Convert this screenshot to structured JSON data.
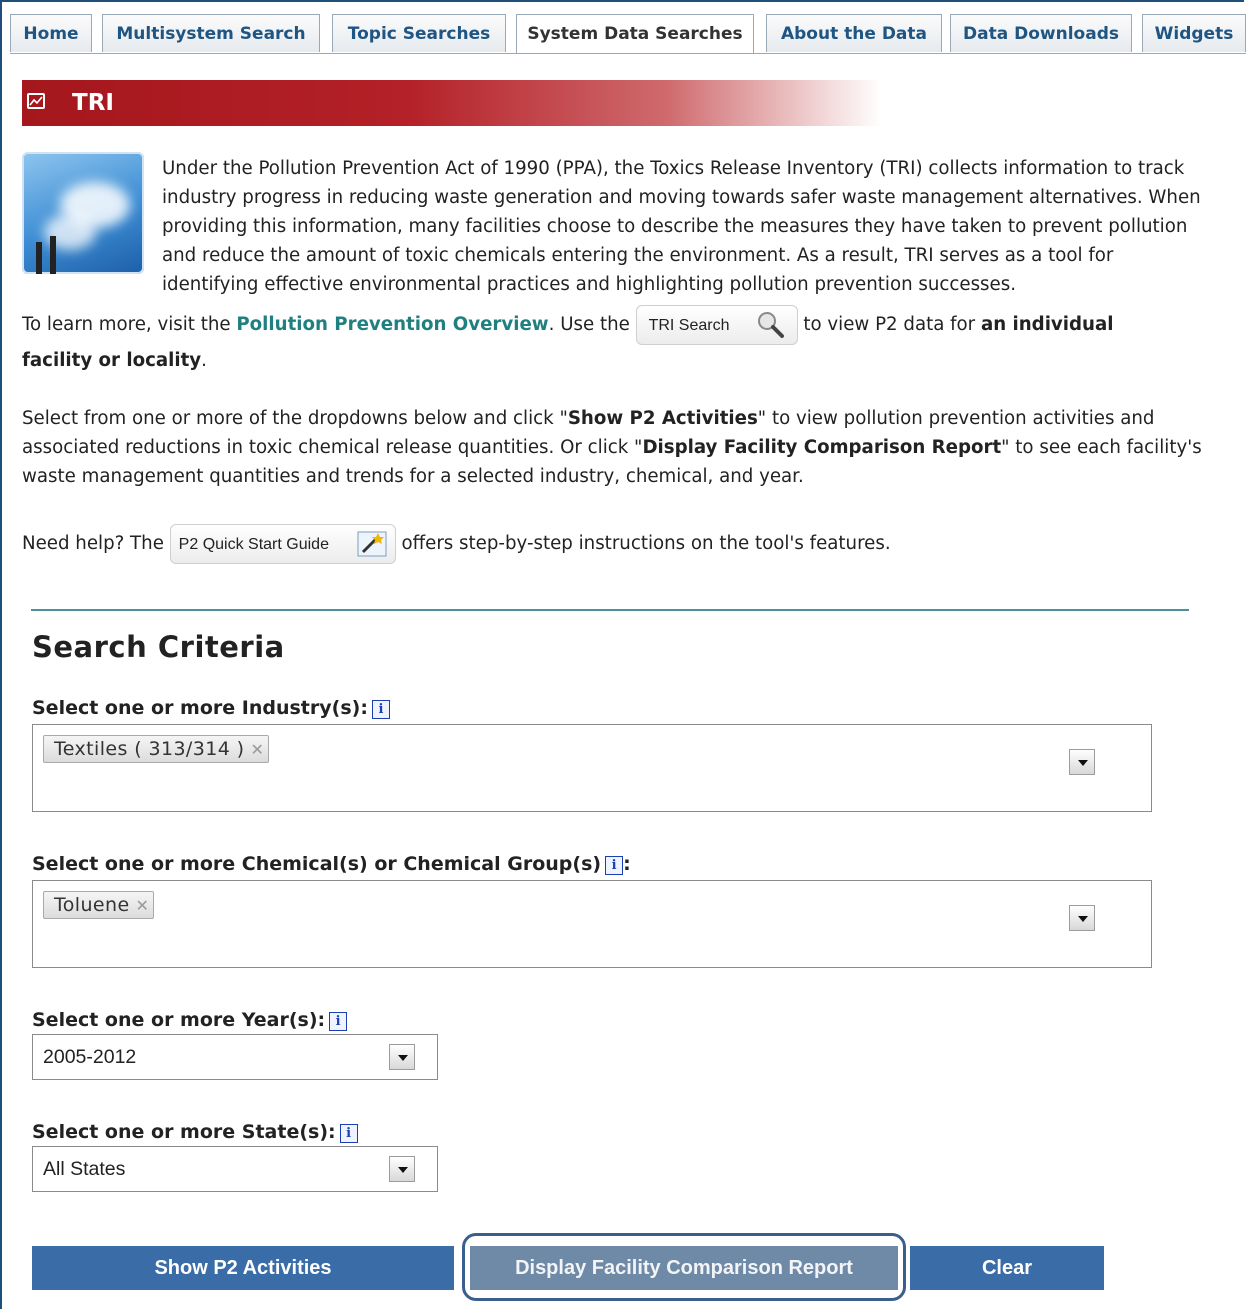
{
  "tabs": [
    {
      "label": "Home",
      "active": false
    },
    {
      "label": "Multisystem Search",
      "active": false
    },
    {
      "label": "Topic Searches",
      "active": false
    },
    {
      "label": "System Data Searches",
      "active": true
    },
    {
      "label": "About the Data",
      "active": false
    },
    {
      "label": "Data Downloads",
      "active": false
    },
    {
      "label": "Widgets",
      "active": false
    }
  ],
  "banner": {
    "title": "TRI",
    "icon": "chart-icon"
  },
  "intro": {
    "image": "smokestack-photo",
    "text": "Under the Pollution Prevention Act of 1990 (PPA), the Toxics Release Inventory (TRI) collects information to track\nindustry progress in reducing waste generation and moving towards safer waste management alternatives. When\nproviding this information, many facilities choose to describe the measures they have taken to prevent pollution\nand reduce the amount of toxic chemicals entering the environment. As a result, TRI serves as a tool for\nidentifying effective environmental practices and highlighting pollution prevention successes."
  },
  "learn_more": {
    "prefix": "To learn more, visit the ",
    "link": "Pollution Prevention Overview",
    "middle": ". Use the ",
    "button": "TRI Search",
    "suffix": " to view P2 data for ",
    "bold": "an individual",
    "line2_bold": "facility or locality",
    "line2_end": "."
  },
  "select_instructions": {
    "p1": "Select from one or more of the dropdowns below and click \"",
    "b1": "Show P2 Activities",
    "p2": "\" to view pollution prevention activities and associated reductions in toxic chemical release quantities. Or click \"",
    "b2": "Display Facility Comparison Report",
    "p3": "\" to see each facility's waste management quantities and trends for a selected industry, chemical, and year."
  },
  "help": {
    "prefix": "Need help? The ",
    "button": "P2 Quick Start Guide",
    "suffix": " offers step-by-step instructions on the tool's features."
  },
  "search_criteria": {
    "title": "Search Criteria",
    "industry": {
      "label": "Select one or more Industry(s):",
      "chip": "Textiles ( 313/314 )"
    },
    "chemical": {
      "label": "Select one or more Chemical(s) or Chemical Group(s)",
      "label_suffix": ":",
      "chip": "Toluene"
    },
    "year": {
      "label": "Select one or more Year(s):",
      "value": "2005-2012"
    },
    "state": {
      "label": "Select one or more State(s):",
      "value": "All States"
    }
  },
  "buttons": {
    "show": "Show P2 Activities",
    "report": "Display Facility Comparison Report",
    "clear": "Clear"
  },
  "colors": {
    "tab_text": "#1f5582",
    "banner_red": "#a4171c",
    "link": "#208080",
    "button_blue": "#3a6da8"
  }
}
